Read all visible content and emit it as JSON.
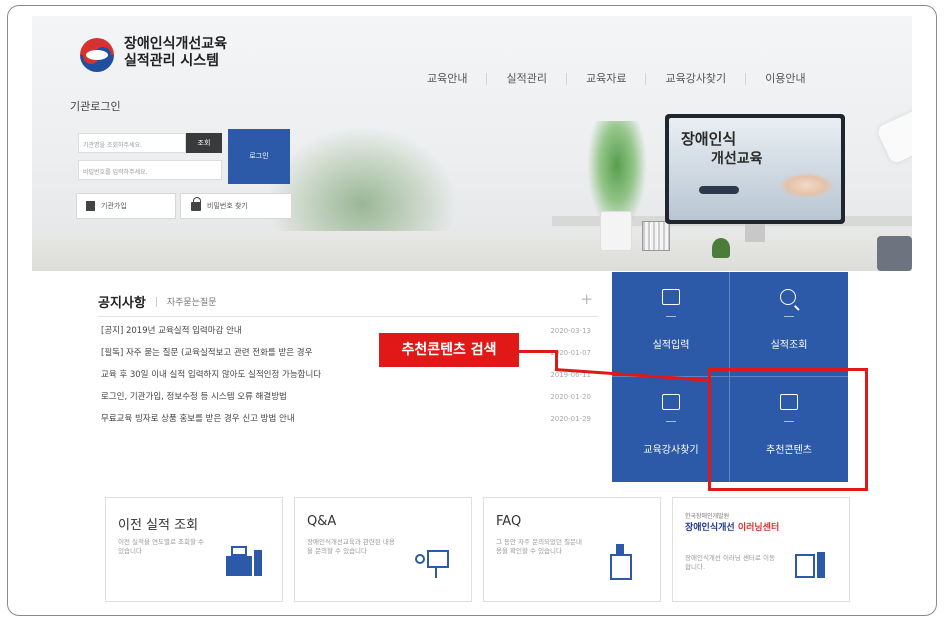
{
  "site": {
    "title_line1": "장애인식개선교육",
    "title_line2": "실적관리 시스템"
  },
  "gnb": [
    "교육안내",
    "실적관리",
    "교육자료",
    "교육강사찾기",
    "이용안내"
  ],
  "hero": {
    "monitor_line1": "장애인식",
    "monitor_line2": "개선교육"
  },
  "login": {
    "label": "기관로그인",
    "id_placeholder": "기관명을 조회하주세요.",
    "pw_placeholder": "비밀번호를 입력하주세요.",
    "lookup_button": "조회",
    "login_button": "로그인",
    "join_button": "기관가입",
    "find_pw_button": "비밀번호 찾기"
  },
  "notice": {
    "tab_main": "공지사항",
    "tab_sub": "자주묻는질문",
    "more": "+",
    "items": [
      {
        "title": "[공지] 2019년 교육실적 입력마감 안내",
        "date": "2020-03-13"
      },
      {
        "title": "[필독] 자주 묻는 질문 (교육실적보고 관련 전화를 받은 경우",
        "date": "2020-01-07"
      },
      {
        "title": "교육 후 30일 이내 실적 입력하지 않아도 실적인정 가능합니다",
        "date": "2019-06-11"
      },
      {
        "title": "로그인, 기관가입, 정보수정 등 시스템 오류 해결방법",
        "date": "2020-01-20"
      },
      {
        "title": "무료교육 빙자로 상품 홍보를 받은 경우 신고 방법 안내",
        "date": "2020-01-29"
      }
    ]
  },
  "callout": {
    "label": "추천콘텐츠 검색",
    "accent_color": "#e01818"
  },
  "quick": {
    "bg_color": "#2c5aa8",
    "tiles": [
      {
        "label": "실적입력",
        "icon": "monitor-icon"
      },
      {
        "label": "실적조회",
        "icon": "magnifier-icon"
      },
      {
        "label": "교육강사찾기",
        "icon": "profile-icon"
      },
      {
        "label": "추천콘텐츠",
        "icon": "media-icon"
      }
    ]
  },
  "cards": [
    {
      "title": "이전 실적 조회",
      "desc": "이전 실적을 연도별로 조회할 수 있습니다",
      "icon": "printer-icon"
    },
    {
      "title": "Q&A",
      "desc": "장애인식개선교육과 관련된 내용을 문의할 수 있습니다",
      "icon": "presenter-icon"
    },
    {
      "title": "FAQ",
      "desc": "그 동안 자주 문의되었던 질문내용을 확인할 수 있습니다",
      "icon": "document-icon"
    },
    {
      "brand_top": "한국장애인개발원",
      "brand_a": "장애인식개선 ",
      "brand_b": "이러닝센터",
      "desc": "장애인식개선 이러닝 센터로 이동합니다.",
      "icon": "book-icon"
    }
  ]
}
